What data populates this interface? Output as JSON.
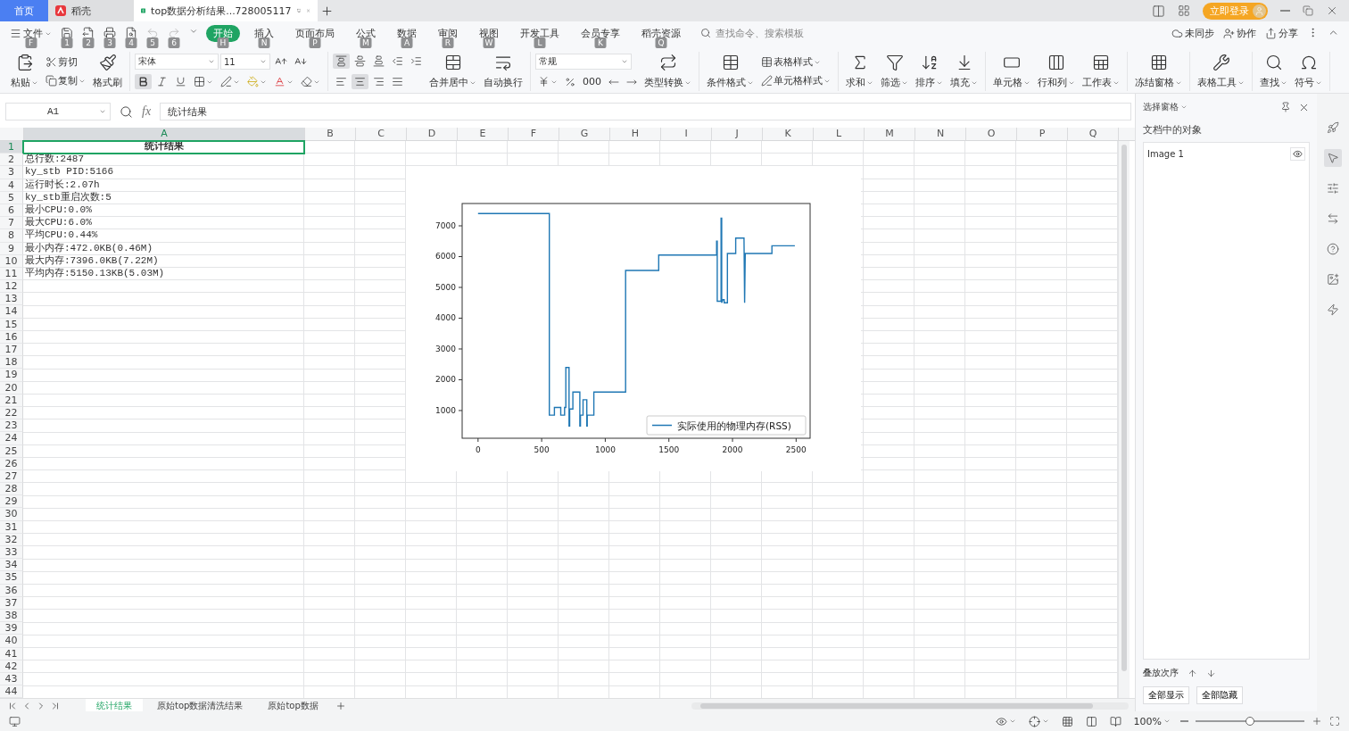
{
  "tabs": [
    {
      "kind": "home",
      "label": "首页",
      "selected": false
    },
    {
      "kind": "app",
      "label": "稻壳",
      "selected": false
    },
    {
      "kind": "doc",
      "label": "top数据分析结果...728005117",
      "selected": true
    }
  ],
  "login_button": "立即登录",
  "menu": {
    "file": {
      "label": "文件",
      "key": "F"
    },
    "quick_access": [
      {
        "key": "1",
        "disabled": false
      },
      {
        "key": "2",
        "disabled": false
      },
      {
        "key": "3",
        "disabled": false
      },
      {
        "key": "4",
        "disabled": false
      },
      {
        "key": "5",
        "disabled": true
      },
      {
        "key": "6",
        "disabled": true
      }
    ],
    "tabs": [
      {
        "label": "开始",
        "key": "H",
        "selected": true
      },
      {
        "label": "插入",
        "key": "N",
        "selected": false
      },
      {
        "label": "页面布局",
        "key": "P",
        "selected": false
      },
      {
        "label": "公式",
        "key": "M",
        "selected": false
      },
      {
        "label": "数据",
        "key": "A",
        "selected": false
      },
      {
        "label": "审阅",
        "key": "R",
        "selected": false
      },
      {
        "label": "视图",
        "key": "W",
        "selected": false
      },
      {
        "label": "开发工具",
        "key": "L",
        "selected": false
      },
      {
        "label": "会员专享",
        "key": "K",
        "selected": false
      },
      {
        "label": "稻壳资源",
        "key": "Q",
        "selected": false
      }
    ],
    "search": {
      "placeholder": "查找命令、搜索模板"
    },
    "actions": [
      "未同步",
      "协作",
      "分享"
    ]
  },
  "ribbon": {
    "paste": "粘贴",
    "cut": "剪切",
    "copy": "复制",
    "format_painter": "格式刷",
    "font": "宋体",
    "font_size": "11",
    "font_styles": [
      {
        "on": true
      },
      {
        "on": false
      },
      {
        "on": false
      }
    ],
    "vertical_align": [
      {
        "on": true
      },
      {
        "on": false
      },
      {
        "on": false
      }
    ],
    "horizontal_align": [
      {
        "on": false
      },
      {
        "on": true
      },
      {
        "on": false
      },
      {
        "on": false
      }
    ],
    "merge": "合并居中",
    "wrap": "自动换行",
    "number_format": "常规",
    "thousands": "000",
    "convert": "类型转换",
    "conditional": "条件格式",
    "table_style": "表格样式",
    "cell_style": "单元格样式",
    "tools": [
      "求和",
      "筛选",
      "排序",
      "填充",
      "单元格",
      "行和列",
      "工作表",
      "冻结窗格",
      "表格工具",
      "查找",
      "符号"
    ]
  },
  "formula_bar": {
    "cell": "A1",
    "fx": "fx",
    "value": "统计结果"
  },
  "sheet": {
    "columns": [
      {
        "label": "A",
        "selected": true
      },
      {
        "label": "B",
        "selected": false
      },
      {
        "label": "C",
        "selected": false
      },
      {
        "label": "D",
        "selected": false
      },
      {
        "label": "E",
        "selected": false
      },
      {
        "label": "F",
        "selected": false
      },
      {
        "label": "G",
        "selected": false
      },
      {
        "label": "H",
        "selected": false
      },
      {
        "label": "I",
        "selected": false
      },
      {
        "label": "J",
        "selected": false
      },
      {
        "label": "K",
        "selected": false
      },
      {
        "label": "L",
        "selected": false
      },
      {
        "label": "M",
        "selected": false
      },
      {
        "label": "N",
        "selected": false
      },
      {
        "label": "O",
        "selected": false
      },
      {
        "label": "P",
        "selected": false
      },
      {
        "label": "Q",
        "selected": false
      }
    ],
    "rows": [
      {
        "number": "1",
        "a": "统计结果",
        "kind": "title",
        "selected": true
      },
      {
        "number": "2",
        "a": "总行数:2487",
        "selected": false
      },
      {
        "number": "3",
        "a": "ky_stb PID:5166",
        "selected": false
      },
      {
        "number": "4",
        "a": "运行时长:2.07h",
        "selected": false
      },
      {
        "number": "5",
        "a": "ky_stb重启次数:5",
        "selected": false
      },
      {
        "number": "6",
        "a": "最小CPU:0.0%",
        "selected": false
      },
      {
        "number": "7",
        "a": "最大CPU:6.0%",
        "selected": false
      },
      {
        "number": "8",
        "a": "平均CPU:0.44%",
        "selected": false
      },
      {
        "number": "9",
        "a": "最小内存:472.0KB(0.46M)",
        "selected": false
      },
      {
        "number": "10",
        "a": "最大内存:7396.0KB(7.22M)",
        "selected": false
      },
      {
        "number": "11",
        "a": "平均内存:5150.13KB(5.03M)",
        "selected": false
      },
      {
        "number": "12",
        "selected": false
      },
      {
        "number": "13",
        "selected": false
      },
      {
        "number": "14",
        "selected": false
      },
      {
        "number": "15",
        "selected": false
      },
      {
        "number": "16",
        "selected": false
      },
      {
        "number": "17",
        "selected": false
      },
      {
        "number": "18",
        "selected": false
      },
      {
        "number": "19",
        "selected": false
      },
      {
        "number": "20",
        "selected": false
      },
      {
        "number": "21",
        "selected": false
      },
      {
        "number": "22",
        "selected": false
      },
      {
        "number": "23",
        "selected": false
      },
      {
        "number": "24",
        "selected": false
      },
      {
        "number": "25",
        "selected": false
      },
      {
        "number": "26",
        "selected": false
      },
      {
        "number": "27",
        "selected": false
      },
      {
        "number": "28",
        "selected": false
      },
      {
        "number": "29",
        "selected": false
      },
      {
        "number": "30",
        "selected": false
      },
      {
        "number": "31",
        "selected": false
      },
      {
        "number": "32",
        "selected": false
      },
      {
        "number": "33",
        "selected": false
      },
      {
        "number": "34",
        "selected": false
      },
      {
        "number": "35",
        "selected": false
      },
      {
        "number": "36",
        "selected": false
      },
      {
        "number": "37",
        "selected": false
      },
      {
        "number": "38",
        "selected": false
      },
      {
        "number": "39",
        "selected": false
      },
      {
        "number": "40",
        "selected": false
      },
      {
        "number": "41",
        "selected": false
      },
      {
        "number": "42",
        "selected": false
      },
      {
        "number": "43",
        "selected": false
      },
      {
        "number": "44",
        "selected": false
      }
    ],
    "chart": {
      "chart_data": {
        "type": "line",
        "xlim": [
          -125,
          2610
        ],
        "ylim": [
          100,
          7725
        ],
        "xticks": [
          0,
          500,
          1000,
          1500,
          2000,
          2500
        ],
        "yticks": [
          1000,
          2000,
          3000,
          4000,
          5000,
          6000,
          7000
        ],
        "x": [
          0,
          560,
          560,
          600,
          600,
          650,
          650,
          680,
          680,
          690,
          690,
          715,
          715,
          720,
          720,
          745,
          745,
          800,
          800,
          805,
          805,
          825,
          825,
          855,
          855,
          858,
          858,
          910,
          910,
          1160,
          1160,
          1420,
          1420,
          1875,
          1875,
          1880,
          1880,
          1910,
          1910,
          1915,
          1915,
          1925,
          1935,
          1935,
          1960,
          1960,
          2025,
          2025,
          2090,
          2095,
          2100,
          2310,
          2310,
          2490
        ],
        "series": [
          {
            "name": "实际使用的物理内存(RSS)",
            "color": "#1f77b4",
            "values": [
              7400,
              7400,
              850,
              850,
              1100,
              1100,
              850,
              850,
              1100,
              1100,
              2400,
              2400,
              500,
              500,
              1050,
              1050,
              1600,
              1600,
              500,
              500,
              850,
              850,
              1350,
              1350,
              500,
              500,
              850,
              850,
              1600,
              1600,
              5550,
              5550,
              6050,
              6050,
              6500,
              6500,
              4550,
              4550,
              7250,
              7250,
              4500,
              4600,
              4600,
              4500,
              4500,
              6100,
              6100,
              6600,
              6600,
              4500,
              6100,
              6100,
              6350,
              6350
            ]
          }
        ]
      }
    }
  },
  "selection_pane": {
    "title": "选择窗格",
    "heading": "文档中的对象",
    "objects": [
      {
        "name": "Image 1",
        "visible": true
      }
    ],
    "order_label": "叠放次序",
    "buttons": [
      "全部显示",
      "全部隐藏"
    ]
  },
  "sheet_tabs": [
    {
      "label": "统计结果",
      "selected": true
    },
    {
      "label": "原始top数据清洗结果",
      "selected": false
    },
    {
      "label": "原始top数据",
      "selected": false
    }
  ],
  "status_bar": {
    "zoom": "100%",
    "zoom_slider": {
      "level": 0.5
    }
  }
}
